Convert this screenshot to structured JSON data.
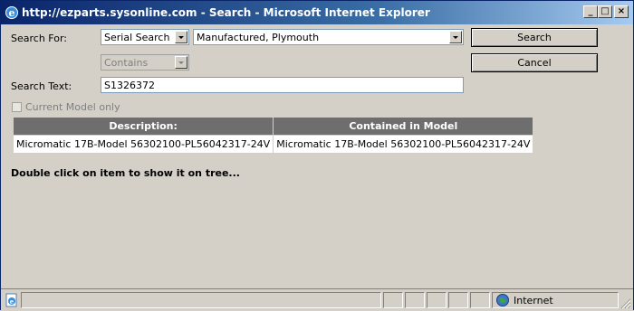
{
  "window": {
    "title": "http://ezparts.sysonline.com - Search - Microsoft Internet Explorer",
    "controls": {
      "minimize": "_",
      "maximize": "□",
      "close": "×"
    }
  },
  "form": {
    "search_for_label": "Search For:",
    "search_type": "Serial Search",
    "manufacturer": "Manufactured, Plymouth",
    "match_mode": "Contains",
    "search_text_label": "Search Text:",
    "search_text_value": "S1326372",
    "current_model_only_label": "Current Model only",
    "search_button": "Search",
    "cancel_button": "Cancel"
  },
  "results": {
    "columns": [
      "Description:",
      "Contained in Model"
    ],
    "rows": [
      [
        "Micromatic 17B-Model 56302100-PL56042317-24V",
        "Micromatic 17B-Model 56302100-PL56042317-24V"
      ]
    ]
  },
  "hint": "Double click on item to show it on tree...",
  "statusbar": {
    "zone": "Internet",
    "icons": {
      "page": "ie-page-icon",
      "zone": "globe-icon"
    }
  }
}
